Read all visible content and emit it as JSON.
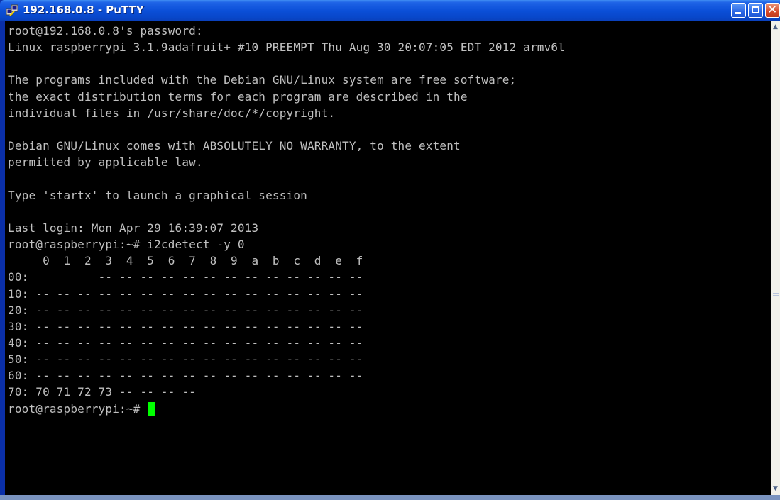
{
  "window": {
    "title": "192.168.0.8 - PuTTY",
    "app_icon": "putty-icon",
    "controls": [
      "minimize-icon",
      "maximize-icon",
      "close-icon"
    ]
  },
  "terminal": {
    "lines": [
      "root@192.168.0.8's password:",
      "Linux raspberrypi 3.1.9adafruit+ #10 PREEMPT Thu Aug 30 20:07:05 EDT 2012 armv6l",
      "",
      "The programs included with the Debian GNU/Linux system are free software;",
      "the exact distribution terms for each program are described in the",
      "individual files in /usr/share/doc/*/copyright.",
      "",
      "Debian GNU/Linux comes with ABSOLUTELY NO WARRANTY, to the extent",
      "permitted by applicable law.",
      "",
      "Type 'startx' to launch a graphical session",
      "",
      "Last login: Mon Apr 29 16:39:07 2013",
      "root@raspberrypi:~# i2cdetect -y 0",
      "     0  1  2  3  4  5  6  7  8  9  a  b  c  d  e  f",
      "00:          -- -- -- -- -- -- -- -- -- -- -- -- --",
      "10: -- -- -- -- -- -- -- -- -- -- -- -- -- -- -- --",
      "20: -- -- -- -- -- -- -- -- -- -- -- -- -- -- -- --",
      "30: -- -- -- -- -- -- -- -- -- -- -- -- -- -- -- --",
      "40: -- -- -- -- -- -- -- -- -- -- -- -- -- -- -- --",
      "50: -- -- -- -- -- -- -- -- -- -- -- -- -- -- -- --",
      "60: -- -- -- -- -- -- -- -- -- -- -- -- -- -- -- --",
      "70: 70 71 72 73 -- -- -- --"
    ],
    "prompt": "root@raspberrypi:~# ",
    "text_color": "#c0c0c0",
    "background_color": "#000000",
    "cursor_color": "#00ff00"
  }
}
